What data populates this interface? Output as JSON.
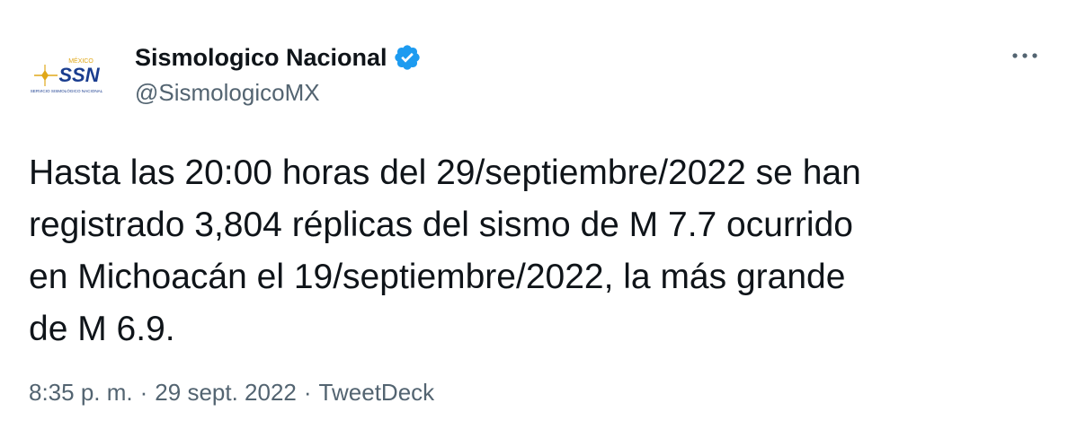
{
  "tweet": {
    "avatar": {
      "brand_text": "SSN",
      "country_text": "MÉXICO",
      "sub_text": "SERVICIO SISMOLÓGICO NACIONAL"
    },
    "author": {
      "display_name": "Sismologico Nacional",
      "handle": "@SismologicoMX",
      "verified": true
    },
    "more_icon": "more-horizontal-icon",
    "text": "Hasta las 20:00 horas del 29/septiembre/2022 se han\nregistrado 3,804 réplicas del sismo de M 7.7 ocurrido\nen Michoacán el 19/septiembre/2022, la más grande\nde M 6.9.",
    "meta": {
      "time": "8:35 p. m.",
      "separator": "·",
      "date": "29 sept. 2022",
      "source": "TweetDeck"
    }
  },
  "colors": {
    "text_primary": "#0f1419",
    "text_secondary": "#536471",
    "verified_blue": "#1d9bf0",
    "brand_blue": "#1a3d8f",
    "brand_gold": "#e0a81a"
  }
}
